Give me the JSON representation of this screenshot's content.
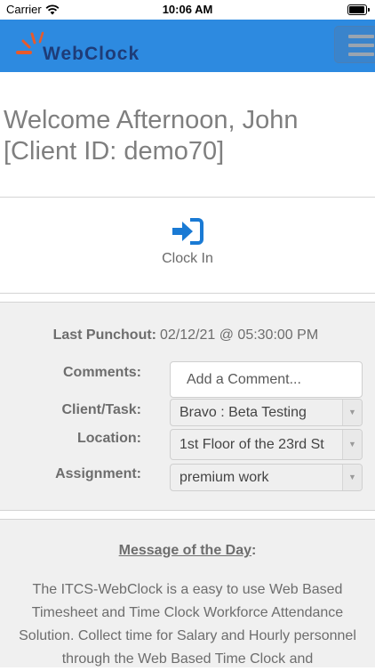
{
  "status_bar": {
    "carrier": "Carrier",
    "time": "10:06 AM"
  },
  "header": {
    "logo_text": "WebClock",
    "menu_icon": "hamburger-menu-icon",
    "brand_color": "#2d8ae0"
  },
  "welcome": {
    "line1": "Welcome Afternoon, John",
    "line2": "[Client ID: demo70]"
  },
  "clock_action": {
    "icon": "sign-in-icon",
    "label": "Clock In",
    "icon_color": "#1a7ad4"
  },
  "form": {
    "last_punchout_label": "Last Punchout:",
    "last_punchout_value": "02/12/21 @ 05:30:00 PM",
    "comments_label": "Comments:",
    "comments_placeholder": "Add a Comment...",
    "client_task_label": "Client/Task:",
    "client_task_value": "Bravo : Beta Testing",
    "location_label": "Location:",
    "location_value": "1st Floor of the 23rd St",
    "assignment_label": "Assignment:",
    "assignment_value": "premium work"
  },
  "message_of_day": {
    "title": "Message of the Day",
    "title_suffix": ":",
    "body": "The ITCS-WebClock is a easy to use Web Based Timesheet and Time Clock Workforce Attendance Solution. Collect time for Salary and Hourly personnel through the Web Based Time Clock and"
  }
}
